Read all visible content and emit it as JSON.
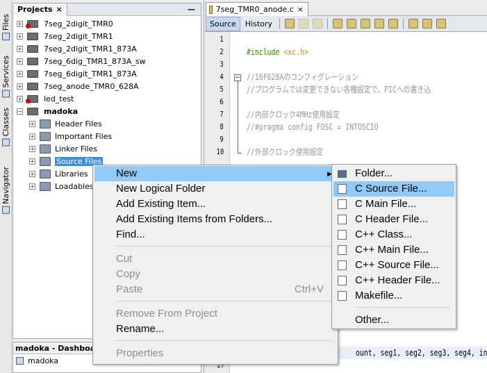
{
  "side_tabs": [
    "Files",
    "Services",
    "Classes",
    "Navigator"
  ],
  "projects": {
    "title": "Projects",
    "close": "×",
    "minimize": "—",
    "items": [
      {
        "label": "7seg_2digit_TMR0",
        "error": true
      },
      {
        "label": "7seg_2digit_TMR1",
        "error": false
      },
      {
        "label": "7seg_2digit_TMR1_873A",
        "error": false
      },
      {
        "label": "7seg_6dig_TMR1_873A_sw",
        "error": false
      },
      {
        "label": "7seg_6digit_TMR1_873A",
        "error": false
      },
      {
        "label": "7seg_anode_TMR0_628A",
        "error": false
      },
      {
        "label": "led_test",
        "error": true
      },
      {
        "label": "madoka",
        "error": false
      }
    ],
    "children": [
      "Header Files",
      "Important Files",
      "Linker Files",
      "Source Files",
      "Libraries",
      "Loadables"
    ],
    "selected": "Source Files"
  },
  "dashboard": {
    "title": "madoka - Dashboard",
    "root": "madoka"
  },
  "editor": {
    "tab": "7seg_TMR0_anode.c",
    "tab_close": "×",
    "toolbar": {
      "source": "Source",
      "history": "History"
    },
    "lines": [
      {
        "n": "1",
        "text": "",
        "cls": ""
      },
      {
        "n": "2",
        "text": "#include",
        "extra": " <xc.h>",
        "cls": "pp"
      },
      {
        "n": "3",
        "text": "",
        "cls": ""
      },
      {
        "n": "4",
        "text": "//16F628Aのコンフィグレーション",
        "cls": "cm"
      },
      {
        "n": "5",
        "text": "//プログラムでは変更できない各種設定で、PICへの書き込",
        "cls": "cm"
      },
      {
        "n": "6",
        "text": "",
        "cls": ""
      },
      {
        "n": "7",
        "text": "//内部クロック4MHz使用設定",
        "cls": "cm"
      },
      {
        "n": "8",
        "text": "//#pragma config FOSC = INTOSCIO",
        "cls": "cm"
      },
      {
        "n": "9",
        "text": "",
        "cls": ""
      },
      {
        "n": "10",
        "text": "//外部クロック使用設定",
        "cls": "cm"
      }
    ],
    "line26_fragment": "ount, seg1, seg2, seg3, seg4, in",
    "line27": "27"
  },
  "context_menu": {
    "items": [
      {
        "label": "New",
        "state": "highlight",
        "submenu": true
      },
      {
        "label": "New Logical Folder",
        "state": "enabled"
      },
      {
        "label": "Add Existing Item...",
        "state": "enabled"
      },
      {
        "label": "Add Existing Items from Folders...",
        "state": "enabled"
      },
      {
        "label": "Find...",
        "state": "enabled"
      },
      {
        "label": "Cut",
        "state": "disabled"
      },
      {
        "label": "Copy",
        "state": "disabled"
      },
      {
        "label": "Paste",
        "state": "disabled",
        "shortcut": "Ctrl+V"
      },
      {
        "label": "Remove From Project",
        "state": "disabled"
      },
      {
        "label": "Rename...",
        "state": "enabled"
      },
      {
        "label": "Properties",
        "state": "disabled"
      }
    ]
  },
  "submenu": {
    "items": [
      {
        "label": "Folder...",
        "icon": "folder-icon"
      },
      {
        "label": "C Source File...",
        "icon": "c-file-icon",
        "highlight": true
      },
      {
        "label": "C Main File...",
        "icon": "c-file-icon"
      },
      {
        "label": "C Header File...",
        "icon": "header-file-icon"
      },
      {
        "label": "C++ Class...",
        "icon": "cpp-file-icon"
      },
      {
        "label": "C++ Main File...",
        "icon": "cpp-file-icon"
      },
      {
        "label": "C++ Source File...",
        "icon": "cpp-file-icon"
      },
      {
        "label": "C++ Header File...",
        "icon": "header-file-icon"
      },
      {
        "label": "Makefile...",
        "icon": "makefile-icon"
      },
      {
        "label": "Other...",
        "icon": ""
      }
    ]
  },
  "colors": {
    "selection": "#3d8fdc",
    "menu_highlight": "#91c9f7",
    "comment": "#969696",
    "preprocessor": "#2e8b00"
  }
}
